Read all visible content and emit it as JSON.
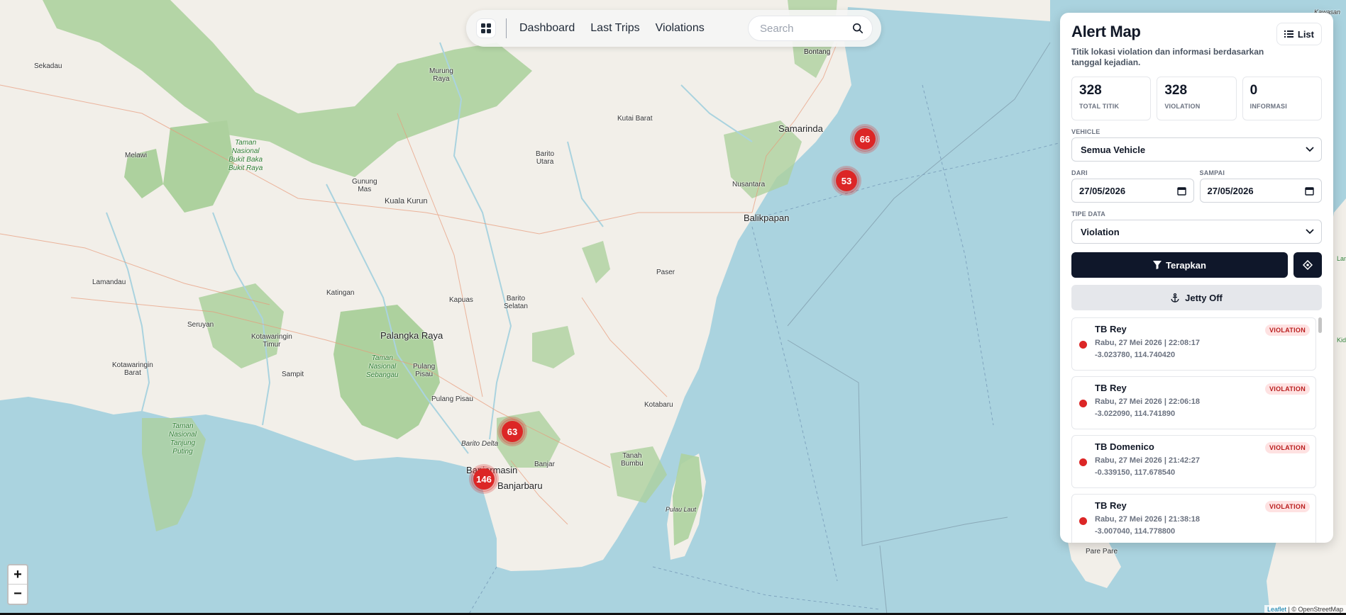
{
  "nav": {
    "links": [
      "Dashboard",
      "Last Trips",
      "Violations"
    ],
    "search_placeholder": "Search"
  },
  "map": {
    "places": {
      "bontang": "Bontang",
      "samarinda": "Samarinda",
      "nusantara": "Nusantara",
      "balikpapan": "Balikpapan",
      "murung_raya": "Murung\nRaya",
      "melawi": "Melawi",
      "sekadau": "Sekadau",
      "kutai_barat": "Kutai Barat",
      "barito_utara": "Barito\nUtara",
      "gunung_mas": "Gunung\nMas",
      "kuala_kurun": "Kuala Kurun",
      "lamandau": "Lamandau",
      "katingan": "Katingan",
      "kapuas": "Kapuas",
      "barito_selatan": "Barito\nSelatan",
      "paser": "Paser",
      "seruyan": "Seruyan",
      "palangka_raya": "Palangka Raya",
      "kotawaringin_timur": "Kotawaringin\nTimur",
      "kotawaringin_barat": "Kotawaringin\nBarat",
      "sampit": "Sampit",
      "pulang_pisau_region": "Pulang\nPisau",
      "pulang_pisau": "Pulang Pisau",
      "barito_delta": "Barito Delta",
      "banjarmasin": "Banjarmasin",
      "banjarbaru": "Banjarbaru",
      "banjar": "Banjar",
      "tanah_bumbu": "Tanah\nBumbu",
      "kotabaru": "Kotabaru",
      "pulau_laut": "Pulau Laut",
      "pare_pare": "Pare Pare",
      "kawasan": "Kawasan",
      "park_bukit_baka": "Taman\nNasional\nBukit Baka\nBukit Raya",
      "park_sebangau": "Taman\nNasional\nSebangau",
      "park_tanjung_puting": "Taman\nNasional\nTanjung\nPuting",
      "lamu": "Lamu",
      "kid": "Kid"
    },
    "clusters": [
      {
        "count": "66",
        "color": "#dc2626"
      },
      {
        "count": "53",
        "color": "#dc2626"
      },
      {
        "count": "63",
        "color": "#dc2626"
      },
      {
        "count": "146",
        "color": "#dc2626"
      }
    ],
    "zoom_in": "+",
    "zoom_out": "−",
    "attribution_leaflet": "Leaflet",
    "attribution_rest": " | © OpenStreetMap"
  },
  "panel": {
    "title": "Alert Map",
    "list_label": "List",
    "subtitle": "Titik lokasi violation dan informasi berdasarkan tanggal kejadian.",
    "stats": [
      {
        "value": "328",
        "label": "TOTAL TITIK"
      },
      {
        "value": "328",
        "label": "VIOLATION"
      },
      {
        "value": "0",
        "label": "INFORMASI"
      }
    ],
    "vehicle_label": "VEHICLE",
    "vehicle_value": "Semua Vehicle",
    "from_label": "DARI",
    "from_value": "27/05/2026",
    "to_label": "SAMPAI",
    "to_value": "27/05/2026",
    "type_label": "TIPE DATA",
    "type_value": "Violation",
    "apply_label": "Terapkan",
    "jetty_label": "Jetty Off",
    "alerts": [
      {
        "name": "TB Rey",
        "badge": "VIOLATION",
        "time": "Rabu, 27 Mei 2026 | 22:08:17",
        "coords": "-3.023780, 114.740420"
      },
      {
        "name": "TB Rey",
        "badge": "VIOLATION",
        "time": "Rabu, 27 Mei 2026 | 22:06:18",
        "coords": "-3.022090, 114.741890"
      },
      {
        "name": "TB Domenico",
        "badge": "VIOLATION",
        "time": "Rabu, 27 Mei 2026 | 21:42:27",
        "coords": "-0.339150, 117.678540"
      },
      {
        "name": "TB Rey",
        "badge": "VIOLATION",
        "time": "Rabu, 27 Mei 2026 | 21:38:18",
        "coords": "-3.007040, 114.778800"
      }
    ],
    "accent": "#0f172a",
    "violation_color": "#dc2626"
  }
}
